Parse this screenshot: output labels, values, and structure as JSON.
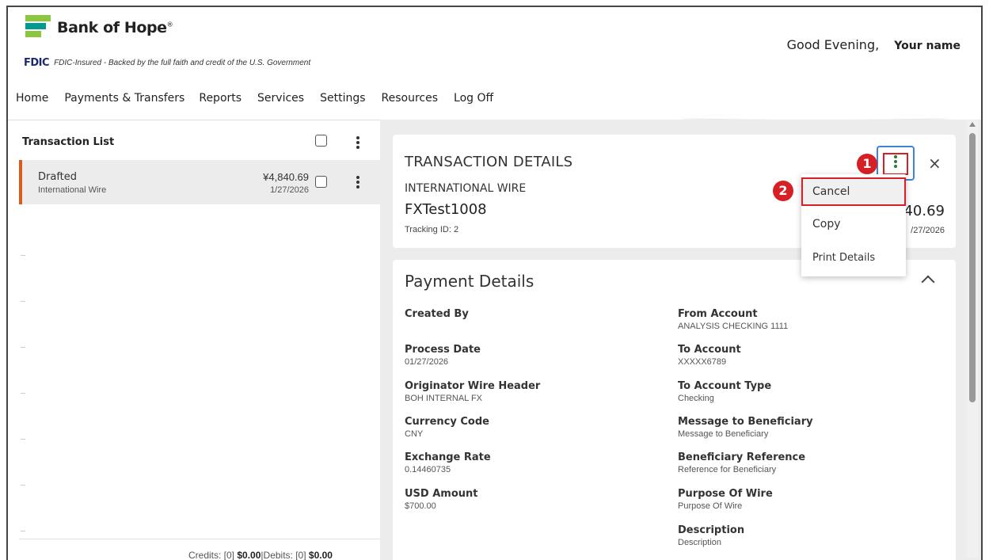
{
  "brand": {
    "name": "Bank of Hope",
    "trademark": "®",
    "fdic_logo": "FDIC",
    "fdic_text": "FDIC-Insured - Backed by the full faith and credit of the U.S. Government",
    "colors": {
      "green": "#8cc63f",
      "teal": "#009a8e",
      "navy": "#1a2a6e"
    }
  },
  "header": {
    "greeting": "Good Evening,",
    "user_name": "Your name"
  },
  "nav": {
    "items": [
      "Home",
      "Payments & Transfers",
      "Reports",
      "Services",
      "Settings",
      "Resources",
      "Log Off"
    ]
  },
  "transaction_list": {
    "title": "Transaction List",
    "rows": [
      {
        "status": "Drafted",
        "type": "International Wire",
        "amount": "¥4,840.69",
        "date": "1/27/2026",
        "accent": "#d85a1c"
      }
    ],
    "footer": {
      "credits_label": "Credits: [0]",
      "credits_value": "$0.00",
      "separator": "|",
      "debits_label": "Debits: [0]",
      "debits_value": "$0.00"
    }
  },
  "transaction_details": {
    "title": "TRANSACTION DETAILS",
    "type": "INTERNATIONAL WIRE",
    "name": "FXTest1008",
    "tracking": "Tracking ID: 2",
    "amount_partial": "40.69",
    "date_partial": "/27/2026",
    "close_icon": "×"
  },
  "action_menu": {
    "items": [
      "Cancel",
      "Copy",
      "Print Details"
    ],
    "highlighted": "Cancel"
  },
  "callouts": {
    "step1": "1",
    "step2": "2",
    "color": "#d71f26"
  },
  "payment_details": {
    "title": "Payment Details",
    "left": [
      {
        "label": "Created By",
        "value": ""
      },
      {
        "label": "Process Date",
        "value": "01/27/2026"
      },
      {
        "label": "Originator Wire Header",
        "value": "BOH INTERNAL FX"
      },
      {
        "label": "Currency Code",
        "value": "CNY"
      },
      {
        "label": "Exchange Rate",
        "value": "0.14460735"
      },
      {
        "label": "USD Amount",
        "value": "$700.00"
      }
    ],
    "right": [
      {
        "label": "From Account",
        "value": "ANALYSIS CHECKING 1111"
      },
      {
        "label": "To Account",
        "value": "XXXXX6789"
      },
      {
        "label": "To Account Type",
        "value": "Checking"
      },
      {
        "label": "Message to Beneficiary",
        "value": "Message to Beneficiary"
      },
      {
        "label": "Beneficiary Reference",
        "value": "Reference for Beneficiary"
      },
      {
        "label": "Purpose Of Wire",
        "value": "Purpose Of Wire"
      },
      {
        "label": "Description",
        "value": "Description"
      }
    ]
  }
}
